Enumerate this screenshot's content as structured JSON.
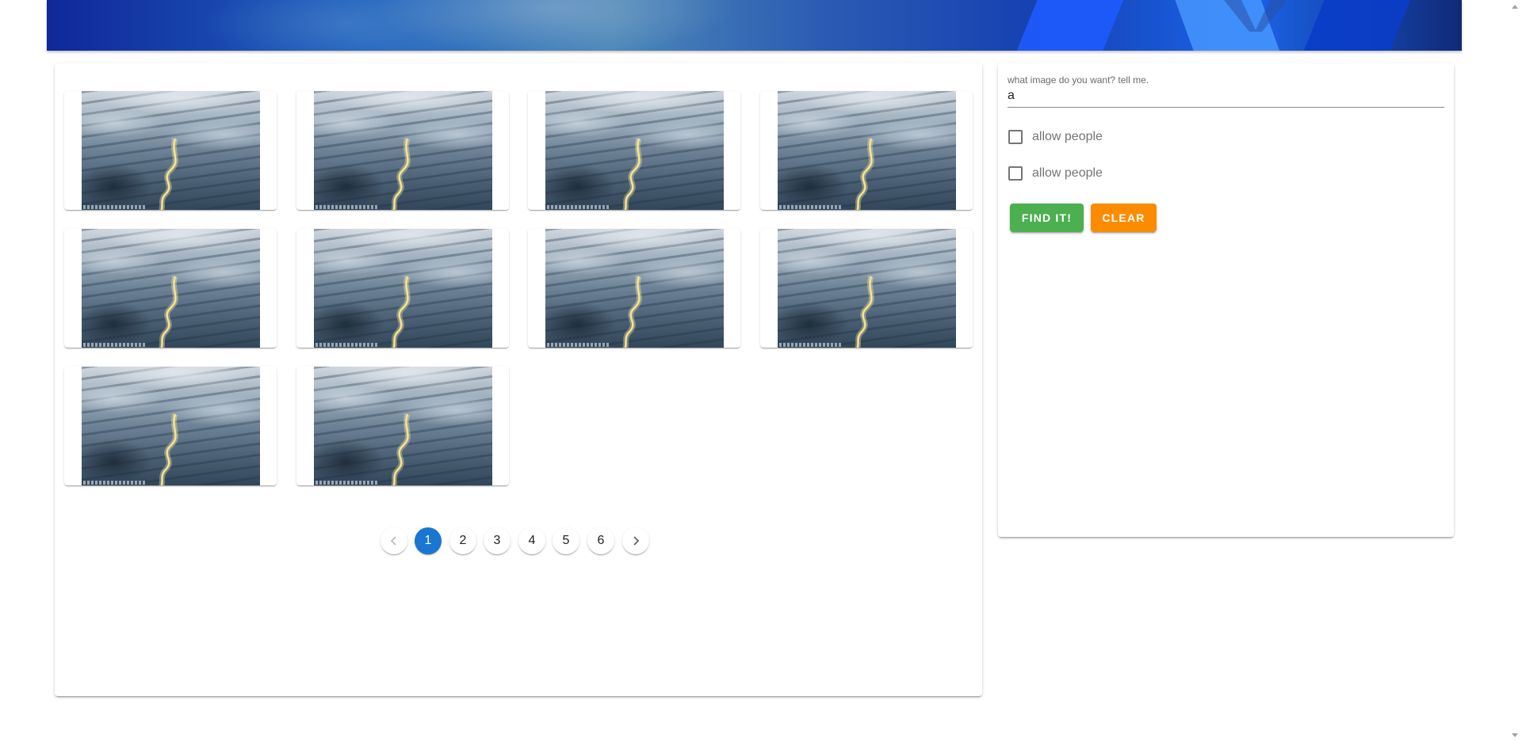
{
  "gallery": {
    "image_count": 10,
    "image_alt": "misty mountains with a glowing river"
  },
  "pagination": {
    "prev_icon": "chevron-left-icon",
    "next_icon": "chevron-right-icon",
    "pages": [
      "1",
      "2",
      "3",
      "4",
      "5",
      "6"
    ],
    "current": "1"
  },
  "search": {
    "label": "what image do you want? tell me.",
    "value": "a",
    "options": [
      {
        "label": "allow people",
        "checked": false
      },
      {
        "label": "allow people",
        "checked": false
      }
    ],
    "find_label": "Find it!",
    "clear_label": "Clear"
  },
  "colors": {
    "primary": "#1976d2",
    "find_button": "#4caf50",
    "clear_button": "#fb8c00"
  }
}
